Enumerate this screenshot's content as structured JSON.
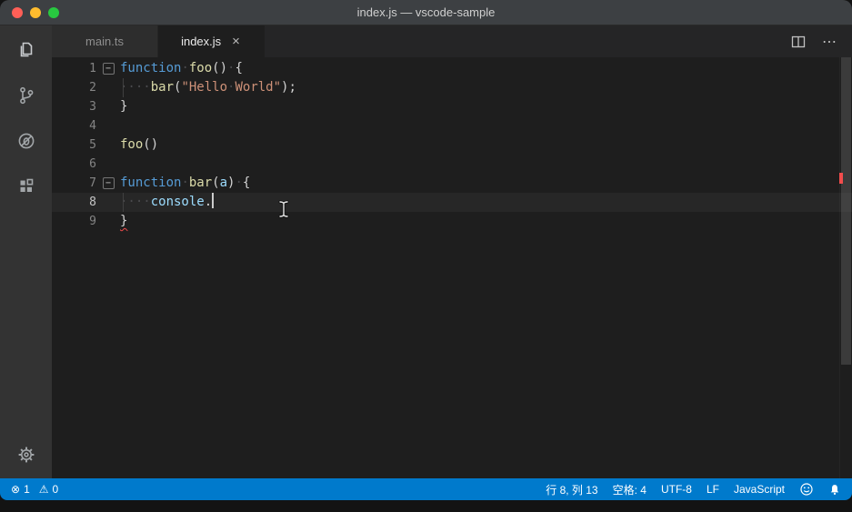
{
  "window": {
    "title": "index.js — vscode-sample"
  },
  "icons": {
    "close": "×",
    "more": "⋯",
    "error": "⊗",
    "warning": "⚠",
    "fold": "−"
  },
  "tabs": [
    {
      "label": "main.ts",
      "active": false
    },
    {
      "label": "index.js",
      "active": true
    }
  ],
  "activity_bar": {
    "items": [
      "explorer",
      "source-control",
      "debug",
      "extensions"
    ],
    "bottom": [
      "settings"
    ]
  },
  "colors": {
    "keyword": "#569CD6",
    "function_name": "#DCDCAA",
    "string": "#CE9178",
    "variable": "#9CDCFE",
    "default_text": "#D4D4D4",
    "whitespace": "#4A4A4D",
    "line_number": "#858585",
    "active_line_number": "#C6C6C6",
    "error": "#F14C4C",
    "status_bar": "#007ACC",
    "editor_bg": "#1E1E1E",
    "activity_bar_bg": "#333333",
    "tab_bar_bg": "#252526",
    "inactive_tab_bg": "#2D2D2D",
    "title_bar_bg": "#3D4043",
    "traffic_red": "#FF5F57",
    "traffic_yellow": "#FEBC2E",
    "traffic_green": "#28C840"
  },
  "editor": {
    "lines": [
      {
        "num": "1",
        "fold": true,
        "tokens": [
          [
            "function",
            "keyword"
          ],
          [
            "·",
            "whitespace"
          ],
          [
            "foo",
            "function_name"
          ],
          [
            "()",
            "default_text"
          ],
          [
            "·",
            "whitespace"
          ],
          [
            "{",
            "default_text"
          ]
        ]
      },
      {
        "num": "2",
        "indent": true,
        "tokens": [
          [
            "····",
            "whitespace"
          ],
          [
            "bar",
            "function_name"
          ],
          [
            "(",
            "default_text"
          ],
          [
            "\"Hello",
            "string"
          ],
          [
            "·",
            "whitespace"
          ],
          [
            "World\"",
            "string"
          ],
          [
            ");",
            "default_text"
          ]
        ]
      },
      {
        "num": "3",
        "tokens": [
          [
            "}",
            "default_text"
          ]
        ]
      },
      {
        "num": "4",
        "tokens": []
      },
      {
        "num": "5",
        "tokens": [
          [
            "foo",
            "function_name"
          ],
          [
            "()",
            "default_text"
          ]
        ]
      },
      {
        "num": "6",
        "tokens": []
      },
      {
        "num": "7",
        "fold": true,
        "tokens": [
          [
            "function",
            "keyword"
          ],
          [
            "·",
            "whitespace"
          ],
          [
            "bar",
            "function_name"
          ],
          [
            "(",
            "default_text"
          ],
          [
            "a",
            "variable"
          ],
          [
            ")",
            "default_text"
          ],
          [
            "·",
            "whitespace"
          ],
          [
            "{",
            "default_text"
          ]
        ]
      },
      {
        "num": "8",
        "indent": true,
        "active": true,
        "caret": true,
        "tokens": [
          [
            "····",
            "whitespace"
          ],
          [
            "console",
            "variable"
          ],
          [
            ".",
            "default_text"
          ]
        ]
      },
      {
        "num": "9",
        "tokens": [
          [
            "}",
            "default_text",
            "squiggle"
          ]
        ]
      }
    ]
  },
  "status_bar": {
    "errors": "1",
    "warnings": "0",
    "cursor": "行 8, 列 13",
    "indentation": "空格: 4",
    "encoding": "UTF-8",
    "eol": "LF",
    "language": "JavaScript"
  }
}
